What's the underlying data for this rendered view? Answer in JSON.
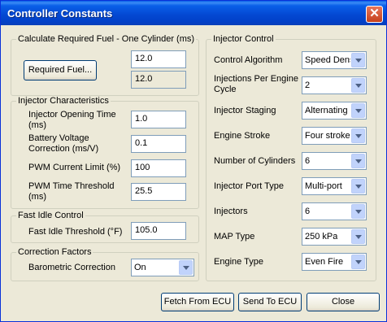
{
  "window": {
    "title": "Controller Constants",
    "close_glyph": "✕"
  },
  "fuel": {
    "group_label": "Calculate Required Fuel - One Cylinder (ms)",
    "button_label": "Required Fuel...",
    "value": "12.0",
    "computed": "12.0"
  },
  "injector_char": {
    "group_label": "Injector Characteristics",
    "opening_time_label": "Injector Opening Time (ms)",
    "opening_time_value": "1.0",
    "battery_label": "Battery Voltage Correction (ms/V)",
    "battery_value": "0.1",
    "pwm_limit_label": "PWM Current Limit (%)",
    "pwm_limit_value": "100",
    "pwm_threshold_label": "PWM Time Threshold (ms)",
    "pwm_threshold_value": "25.5"
  },
  "fast_idle": {
    "group_label": "Fast Idle Control",
    "threshold_label": "Fast Idle Threshold (°F)",
    "threshold_value": "105.0"
  },
  "correction": {
    "group_label": "Correction Factors",
    "baro_label": "Barometric Correction",
    "baro_value": "On"
  },
  "injector_control": {
    "group_label": "Injector Control",
    "algorithm_label": "Control Algorithm",
    "algorithm_value": "Speed Density",
    "injections_label": "Injections Per Engine Cycle",
    "injections_value": "2",
    "staging_label": "Injector Staging",
    "staging_value": "Alternating",
    "stroke_label": "Engine Stroke",
    "stroke_value": "Four stroke",
    "cylinders_label": "Number of Cylinders",
    "cylinders_value": "6",
    "port_label": "Injector Port Type",
    "port_value": "Multi-port",
    "injectors_label": "Injectors",
    "injectors_value": "6",
    "map_label": "MAP Type",
    "map_value": "250 kPa",
    "engine_type_label": "Engine Type",
    "engine_type_value": "Even Fire"
  },
  "buttons": {
    "fetch": "Fetch From ECU",
    "send": "Send To ECU",
    "close": "Close"
  }
}
